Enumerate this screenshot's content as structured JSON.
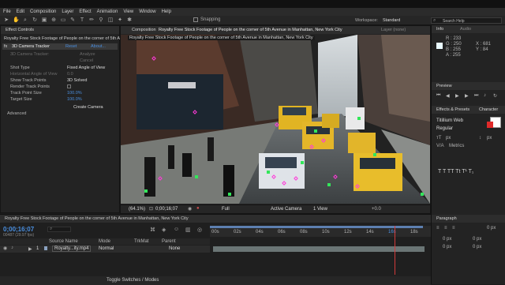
{
  "menu": [
    "File",
    "Edit",
    "Composition",
    "Layer",
    "Effect",
    "Animation",
    "View",
    "Window",
    "Help"
  ],
  "toolbar": {
    "snapping": "Snapping",
    "workspace_label": "Workspace:",
    "workspace_value": "Standard",
    "search_placeholder": "Search Help"
  },
  "effect_controls": {
    "tab": "Effect Controls",
    "layer_name": "Royalty Free Stock Footage of People on the corner of 5th A...",
    "effect_name": "3D Camera Tracker",
    "reset": "Reset",
    "about": "About...",
    "status1": "3D Camera Tracker:",
    "status2": "Analyze",
    "status3": "Cancel",
    "shot_type_label": "Shot Type",
    "shot_type_value": "Fixed Angle of View",
    "hfov_label": "Horizontal Angle of View",
    "hfov_value": "0.0",
    "show_tp_label": "Show Track Points",
    "show_tp_value": "3D Solved",
    "render_tp_label": "Render Track Points",
    "tp_size_label": "Track Point Size",
    "tp_size_value": "100.0%",
    "target_size_label": "Target Size",
    "target_size_value": "100.0%",
    "create_camera": "Create Camera",
    "advanced": "Advanced"
  },
  "composition": {
    "tab": "Composition",
    "title": "Royalty Free Stock Footage of People on the corner of 5th Avenue in Manhattan, New York City",
    "comp_name": "Royalty Free Stock Footage of People on the corner of 5th Avenue in Manhattan, New York City",
    "layer_tab": "Layer  (none)",
    "zoom": "(64.1%)",
    "time": "0;00;16;07",
    "resolution": "Full",
    "camera": "Active Camera",
    "views": "1 View",
    "exposure": "+0.0"
  },
  "timeline": {
    "tab": "Royalty Free Stock Footage of People on the corner of 5th Avenue in Manhattan, New York City",
    "timecode": "0;00;16;07",
    "fps": "00487 (29.97 fps)",
    "col_source": "Source Name",
    "col_mode": "Mode",
    "col_trkmat": "TrkMat",
    "col_parent": "Parent",
    "layer_num": "1",
    "layer_name": "Royalty...ity.mp4",
    "layer_mode": "Normal",
    "layer_parent": "None",
    "ruler": [
      "00s",
      "02s",
      "04s",
      "06s",
      "08s",
      "10s",
      "12s",
      "14s",
      "16s",
      "18s"
    ],
    "toggle": "Toggle Switches / Modes",
    "playhead_seconds": 16
  },
  "info": {
    "tab": "Info",
    "audio": "Audio",
    "r": "R : 233",
    "g": "G : 250",
    "b": "B : 255",
    "a": "A : 255",
    "x": "X : 681",
    "y": "Y : 84"
  },
  "preview": {
    "tab": "Preview"
  },
  "effects_presets": {
    "tab": "Effects & Presets",
    "character": "Character"
  },
  "character": {
    "font": "Titillium Web",
    "style": "Regular",
    "size": "px",
    "leading": "Metrics",
    "px": "px"
  },
  "paragraph": {
    "tab": "Paragraph",
    "v1": "0 px",
    "v2": "0 px",
    "v3": "0 px",
    "v4": "0 px",
    "v5": "0 px"
  }
}
